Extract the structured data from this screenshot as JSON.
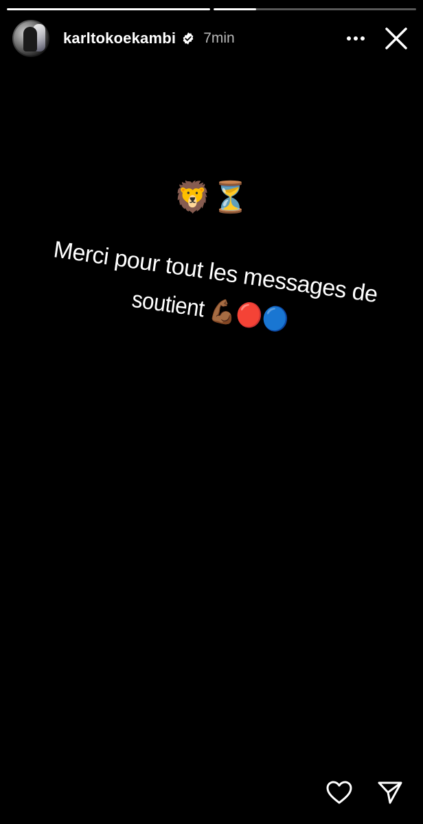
{
  "story": {
    "progress": [
      {
        "name": "segment-1",
        "fill": 1.0
      },
      {
        "name": "segment-2",
        "fill": 0.21
      }
    ]
  },
  "header": {
    "username": "karltokoekambi",
    "verified_icon": "verified-badge-icon",
    "timestamp": "7min",
    "more_icon": "more-options-icon",
    "close_icon": "close-icon"
  },
  "content": {
    "sticker_emojis": "🦁⏳",
    "caption_line1": "Merci pour tout les messages de",
    "caption_line2": "soutient 💪🏾🔴🔵"
  },
  "footer": {
    "like_icon": "heart-icon",
    "share_icon": "send-icon"
  },
  "colors": {
    "background": "#000000",
    "text": "#ffffff",
    "progress_track": "rgba(255,255,255,0.35)"
  }
}
